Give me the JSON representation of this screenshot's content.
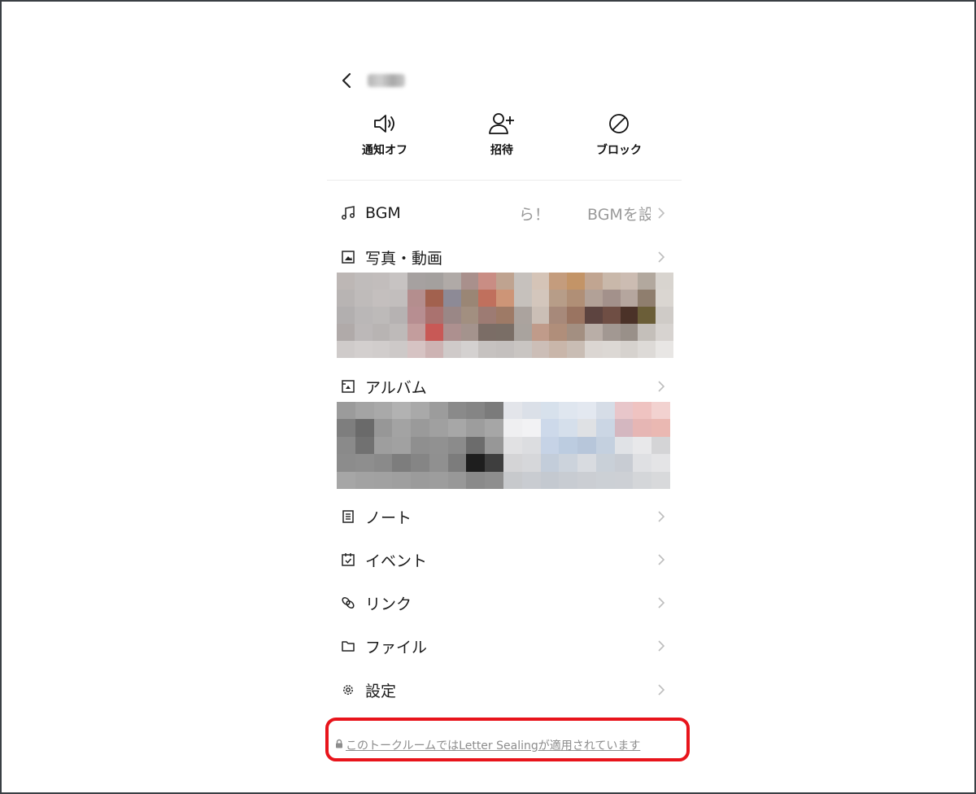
{
  "header": {
    "back_icon": "chevron-left-icon",
    "title": ""
  },
  "actions": [
    {
      "icon": "speaker-icon",
      "label": "通知オフ"
    },
    {
      "icon": "add-friend-icon",
      "label": "招待"
    },
    {
      "icon": "block-icon",
      "label": "ブロック"
    }
  ],
  "menu": {
    "bgm": {
      "icon": "music-note-icon",
      "label": "BGM",
      "snippet": "ら！",
      "hint": "BGMを設"
    },
    "photos": {
      "icon": "photo-icon",
      "label": "写真・動画"
    },
    "album": {
      "icon": "album-icon",
      "label": "アルバム"
    },
    "note": {
      "icon": "note-icon",
      "label": "ノート"
    },
    "event": {
      "icon": "calendar-icon",
      "label": "イベント"
    },
    "link": {
      "icon": "link-icon",
      "label": "リンク"
    },
    "file": {
      "icon": "folder-icon",
      "label": "ファイル"
    },
    "settings": {
      "icon": "gear-icon",
      "label": "設定"
    }
  },
  "footer": {
    "icon": "lock-icon",
    "text": "このトークルームではLetter Sealingが適用されています"
  },
  "colors": {
    "highlight_border": "#e8141b",
    "muted_text": "#8c8c8c",
    "chevron": "#bdbdbd"
  },
  "mosaics": {
    "photos": [
      [
        "#bdb7b5",
        "#c0bcbb",
        "#c2bdbc",
        "#c7c3c2",
        "#a6a1a0",
        "#a4a09e",
        "#b0aaa7",
        "#a9908c",
        "#c98d84",
        "#bfa390",
        "#c6c1bd",
        "#d5c4b7",
        "#c49c7d",
        "#c39467",
        "#c1a591",
        "#c9b8aa",
        "#ccbcb2",
        "#b2a89e",
        "#d8d4cf"
      ],
      [
        "#b8b4b3",
        "#bfbbba",
        "#c4bfbe",
        "#c2bebd",
        "#b48e8e",
        "#a2614e",
        "#8d8a96",
        "#9a8675",
        "#c0705d",
        "#cd9577",
        "#c6c1bc",
        "#d3c6bc",
        "#b79d88",
        "#b08f76",
        "#b2a197",
        "#a3918b",
        "#b5a69e",
        "#8f7e6e",
        "#dad6d1"
      ],
      [
        "#b2afaf",
        "#bab7b7",
        "#bdbab9",
        "#b6b2b2",
        "#b78e91",
        "#aa726f",
        "#9a8786",
        "#a28f80",
        "#9d7b73",
        "#9e7a66",
        "#aba39e",
        "#cbbfb6",
        "#a7897a",
        "#9a7461",
        "#5d4440",
        "#6f4e44",
        "#4b3228",
        "#6b5e38",
        "#cfcbc7"
      ],
      [
        "#b0aaa9",
        "#bcb8b8",
        "#b8b4b3",
        "#bebab9",
        "#c39d9d",
        "#c85956",
        "#ad908f",
        "#a4938d",
        "#7b6d66",
        "#7a6e66",
        "#a9a39e",
        "#c09b8a",
        "#b08e7a",
        "#a38f81",
        "#b9aea7",
        "#a29892",
        "#999089",
        "#c4bfba",
        "#d7d3d0"
      ],
      [
        "#cfcbca",
        "#d3cfce",
        "#d1cdcc",
        "#cdc9c8",
        "#d6c3c3",
        "#cdb3b3",
        "#cfcac9",
        "#d4d1d0",
        "#c6c2c0",
        "#c4c0be",
        "#c9c5c2",
        "#ccbeb7",
        "#c9b6aa",
        "#c9bdb4",
        "#dbd6d2",
        "#dcd8d4",
        "#d6d2ce",
        "#dddad7",
        "#e8e6e4"
      ]
    ],
    "album": [
      [
        "#9b9b9b",
        "#a4a4a4",
        "#a9a9a9",
        "#b2b2b2",
        "#a9a9a9",
        "#9c9c9c",
        "#8a8a8a",
        "#858585",
        "#7b7b7b",
        "#e3e5ea",
        "#dbe0e8",
        "#d7e1ec",
        "#dfe6ef",
        "#e3e8f0",
        "#d6dde7",
        "#e8c6ca",
        "#efc3c1",
        "#f2d2d0"
      ],
      [
        "#7e7e7e",
        "#6a6a6a",
        "#979797",
        "#a3a3a3",
        "#9a9a9a",
        "#a0a0a0",
        "#a7a7a7",
        "#9d9d9d",
        "#a6a6a6",
        "#efeff1",
        "#f2f2f4",
        "#cdd9ea",
        "#d5dfeb",
        "#dfe1e4",
        "#cbd6e4",
        "#d4b7c0",
        "#e6b6b4",
        "#eab8b2"
      ],
      [
        "#8a8a8a",
        "#717171",
        "#9e9e9e",
        "#a1a1a1",
        "#8f8f8f",
        "#919191",
        "#8b8b8b",
        "#6c6c6c",
        "#979797",
        "#e1e1e3",
        "#dcdde0",
        "#c6d3e6",
        "#bccce0",
        "#b7c6da",
        "#c4d0df",
        "#e0e2e6",
        "#e8e8ea",
        "#d4d4d6"
      ],
      [
        "#8c8c8c",
        "#8e8e8e",
        "#8a8a8a",
        "#7d7d7d",
        "#858585",
        "#909090",
        "#7c7c7c",
        "#1e1e1e",
        "#3e3e3e",
        "#d4d4d6",
        "#d6d7da",
        "#c3cdda",
        "#ccd3dc",
        "#d8dbe0",
        "#c9d0d8",
        "#c8ccd3",
        "#dfe0e3",
        "#e4e4e6"
      ],
      [
        "#a6a6a6",
        "#a2a2a2",
        "#a1a1a1",
        "#9f9f9f",
        "#9b9b9b",
        "#9d9d9d",
        "#989898",
        "#8a8a8a",
        "#8e8e8e",
        "#c7c9cc",
        "#c9ccd1",
        "#c4c9d0",
        "#c8ccd2",
        "#cbced3",
        "#ccd0d5",
        "#cdd0d5",
        "#d4d6d9",
        "#d8d9db"
      ]
    ]
  }
}
